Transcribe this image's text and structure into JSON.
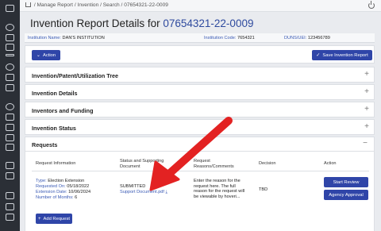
{
  "breadcrumb": {
    "items": [
      "Manage Report",
      "Invention",
      "Search",
      "07654321-22-0009"
    ]
  },
  "header": {
    "title_prefix": "Invention Report Details for",
    "title_number": "07654321-22-0009"
  },
  "info": {
    "institution_name_label": "Institution Name:",
    "institution_name": "DAN'S INSTITUTION",
    "institution_code_label": "Institution Code:",
    "institution_code": "7654321",
    "duns_label": "DUNS/UEI:",
    "duns": "123456789"
  },
  "toolbar": {
    "action_label": "Action",
    "save_label": "Save Invention Report"
  },
  "sections": [
    {
      "label": "Invention/Patent/Utilization Tree",
      "sign": "+"
    },
    {
      "label": "Invention Details",
      "sign": "+"
    },
    {
      "label": "Inventors and Funding",
      "sign": "+"
    },
    {
      "label": "Invention Status",
      "sign": "+"
    }
  ],
  "requests": {
    "label": "Requests",
    "sign": "−",
    "columns": {
      "info": "Request Information",
      "status_line1": "Status and Supporting",
      "status_line2": "Document",
      "reasons_line1": "Request",
      "reasons_line2": "Reasons/Comments",
      "decision": "Decision",
      "action": "Action"
    },
    "row": {
      "type_label": "Type:",
      "type_value": "Election Extension",
      "requested_label": "Requested On:",
      "requested_value": "05/18/2022",
      "extension_label": "Extension Date:",
      "extension_value": "10/06/2024",
      "months_label": "Number of Months:",
      "months_value": "6",
      "status": "SUBMITTED",
      "document": "Support Document.pdf",
      "reasons_line1": "Enter the reason for the",
      "reasons_line2": "request here. The full",
      "reasons_line3": "reason for the request will",
      "reasons_line4": "be viewable by hoveri...",
      "decision": "TBD",
      "start_review_label": "Start Review",
      "agency_approval_label": "Agency Approval"
    },
    "add_label": "Add Request"
  },
  "colors": {
    "brand": "#2f45a8",
    "link": "#3b5bb5",
    "arrow": "#e32222"
  }
}
